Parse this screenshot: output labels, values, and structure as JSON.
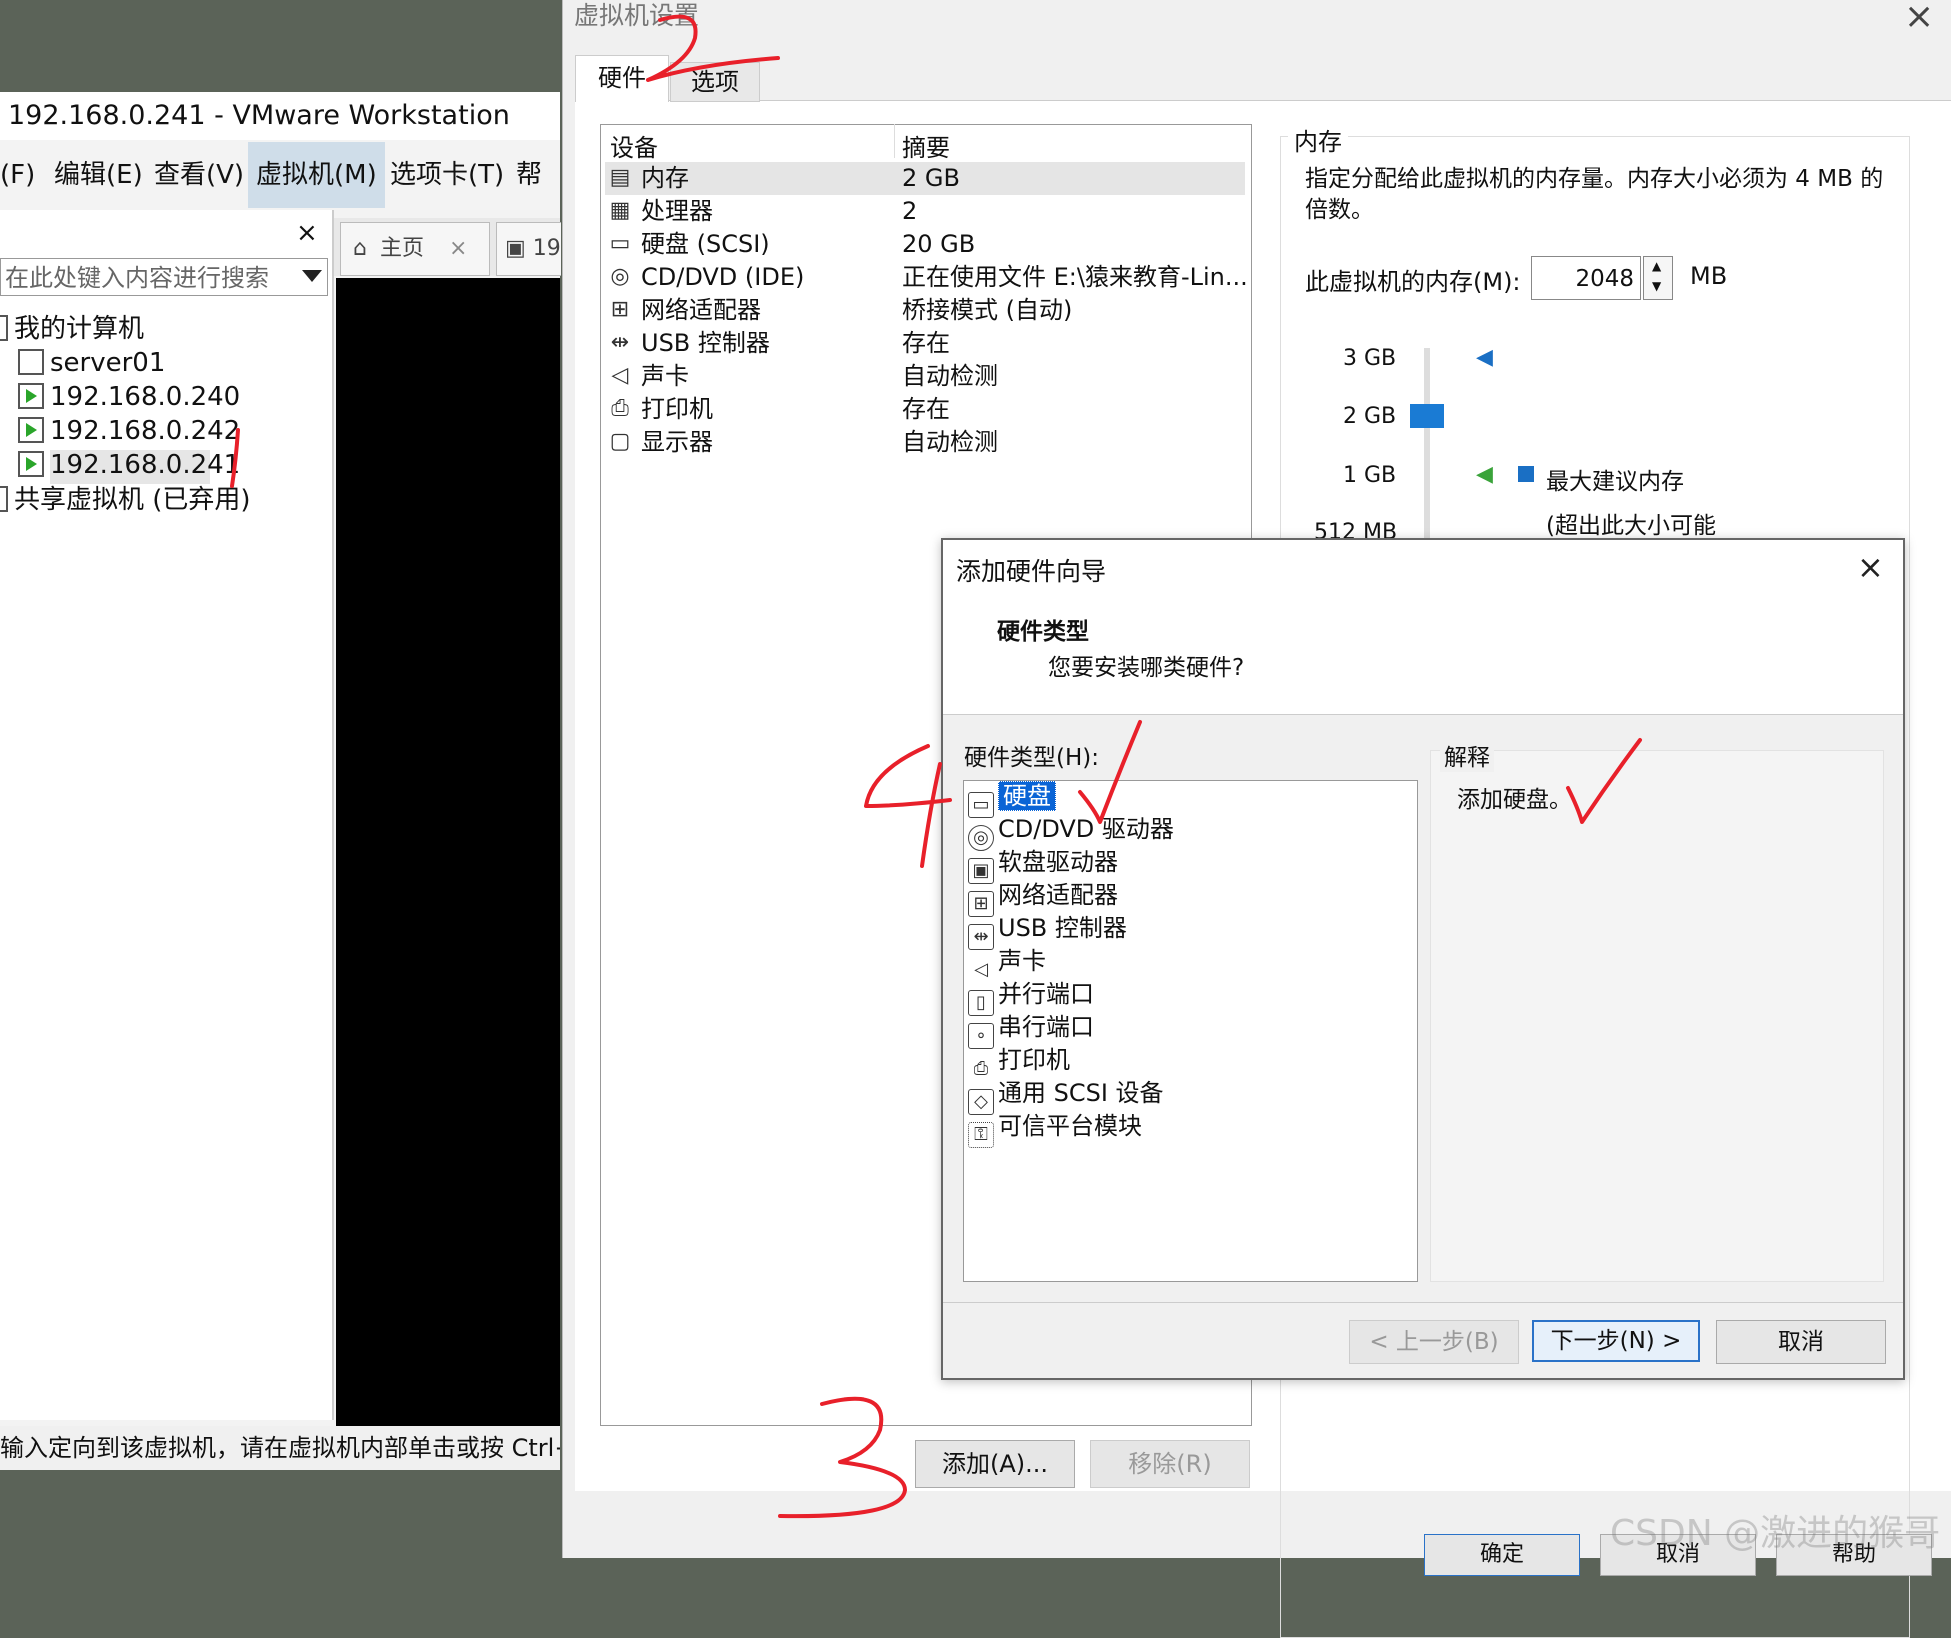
{
  "vmware": {
    "title": "192.168.0.241 - VMware Workstation",
    "menu": [
      "(F)",
      "编辑(E)",
      "查看(V)",
      "虚拟机(M)",
      "选项卡(T)",
      "帮助"
    ],
    "library": {
      "close": "×",
      "search_placeholder": "在此处键入内容进行搜索",
      "root": "我的计算机",
      "vms": [
        "server01",
        "192.168.0.240",
        "192.168.0.242",
        "192.168.0.241"
      ],
      "shared": "共享虚拟机 (已弃用)"
    },
    "tabs": [
      {
        "label": "主页",
        "close": "×"
      },
      {
        "label": "19"
      }
    ],
    "status": "输入定向到该虚拟机，请在虚拟机内部单击或按 Ctrl+G"
  },
  "settings": {
    "title": "虚拟机设置",
    "close": "×",
    "tabs": [
      "硬件",
      "选项"
    ],
    "columns": [
      "设备",
      "摘要"
    ],
    "devices": [
      {
        "icon": "memory-icon",
        "name": "内存",
        "summary": "2 GB"
      },
      {
        "icon": "processor-icon",
        "name": "处理器",
        "summary": "2"
      },
      {
        "icon": "harddisk-icon",
        "name": "硬盘 (SCSI)",
        "summary": "20 GB"
      },
      {
        "icon": "cdrom-icon",
        "name": "CD/DVD (IDE)",
        "summary": "正在使用文件 E:\\猿来教育-Lin..."
      },
      {
        "icon": "network-icon",
        "name": "网络适配器",
        "summary": "桥接模式 (自动)"
      },
      {
        "icon": "usb-icon",
        "name": "USB 控制器",
        "summary": "存在"
      },
      {
        "icon": "sound-icon",
        "name": "声卡",
        "summary": "自动检测"
      },
      {
        "icon": "printer-icon",
        "name": "打印机",
        "summary": "存在"
      },
      {
        "icon": "display-icon",
        "name": "显示器",
        "summary": "自动检测"
      }
    ],
    "memory": {
      "legend": "内存",
      "description": "指定分配给此虚拟机的内存量。内存大小必须为 4 MB 的倍数。",
      "label": "此虚拟机的内存(M):",
      "value": "2048",
      "unit": "MB",
      "ticks": [
        "3 GB",
        "2 GB",
        "1 GB",
        "512 MB"
      ],
      "max_recommended": "最大建议内存",
      "note": "(超出此大小可能"
    },
    "add_button": "添加(A)...",
    "remove_button": "移除(R)",
    "bottom_buttons": [
      "确定",
      "取消",
      "帮助"
    ]
  },
  "wizard": {
    "title": "添加硬件向导",
    "close": "×",
    "heading": "硬件类型",
    "subheading": "您要安装哪类硬件?",
    "list_label": "硬件类型(H):",
    "hardware_types": [
      {
        "icon": "harddisk-icon",
        "label": "硬盘"
      },
      {
        "icon": "cdrom-icon",
        "label": "CD/DVD 驱动器"
      },
      {
        "icon": "floppy-icon",
        "label": "软盘驱动器"
      },
      {
        "icon": "network-icon",
        "label": "网络适配器"
      },
      {
        "icon": "usb-icon",
        "label": "USB 控制器"
      },
      {
        "icon": "sound-icon",
        "label": "声卡"
      },
      {
        "icon": "parallel-port-icon",
        "label": "并行端口"
      },
      {
        "icon": "serial-port-icon",
        "label": "串行端口"
      },
      {
        "icon": "printer-icon",
        "label": "打印机"
      },
      {
        "icon": "scsi-icon",
        "label": "通用 SCSI 设备"
      },
      {
        "icon": "tpm-icon",
        "label": "可信平台模块"
      }
    ],
    "selected_index": 0,
    "explain_label": "解释",
    "explain_text": "添加硬盘。",
    "buttons": {
      "prev": "< 上一步(B)",
      "next": "下一步(N) >",
      "cancel": "取消"
    }
  },
  "watermark": "CSDN @激进的猴哥",
  "annotation_color": "#e8202a"
}
